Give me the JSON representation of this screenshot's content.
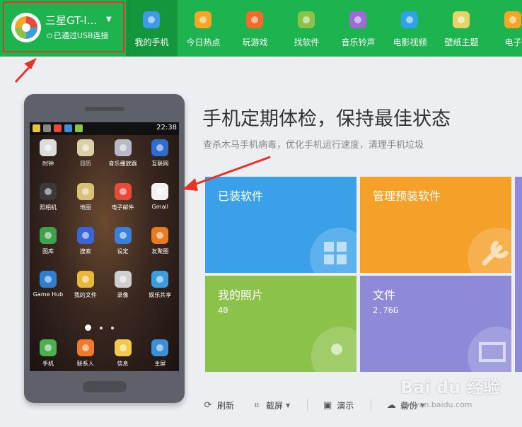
{
  "header": {
    "device_name": "三星GT-I...",
    "connection_status": "已通过USB连接",
    "nav": [
      {
        "label": "我的手机",
        "icon": "phone-icon",
        "color": "#3f9be8",
        "active": true
      },
      {
        "label": "今日热点",
        "icon": "star-icon",
        "color": "#f5a623"
      },
      {
        "label": "玩游戏",
        "icon": "gamepad-icon",
        "color": "#f26b2a"
      },
      {
        "label": "找软件",
        "icon": "android-icon",
        "color": "#8bc34a"
      },
      {
        "label": "音乐铃声",
        "icon": "music-icon",
        "color": "#9b6bd6"
      },
      {
        "label": "电影视频",
        "icon": "play-icon",
        "color": "#2ea4e6"
      },
      {
        "label": "壁纸主题",
        "icon": "wallpaper-icon",
        "color": "#e6d26a"
      },
      {
        "label": "电子",
        "icon": "ebook-icon",
        "color": "#f5a623"
      }
    ]
  },
  "phone": {
    "time": "22:38",
    "apps": [
      {
        "label": "时钟",
        "icon": "clock-icon",
        "color": "#dcdcdc"
      },
      {
        "label": "日历",
        "icon": "calendar-icon",
        "color": "#d9d0a8"
      },
      {
        "label": "音乐播放器",
        "icon": "music-player-icon",
        "color": "#b8b8c8"
      },
      {
        "label": "互联网",
        "icon": "globe-icon",
        "color": "#2f6bd1"
      },
      {
        "label": "照相机",
        "icon": "camera-icon",
        "color": "#3a3a3a"
      },
      {
        "label": "地图",
        "icon": "map-icon",
        "color": "#d8c27a"
      },
      {
        "label": "电子邮件",
        "icon": "email-icon",
        "color": "#e84a3a"
      },
      {
        "label": "Gmail",
        "icon": "gmail-icon",
        "color": "#f2f2f2"
      },
      {
        "label": "图库",
        "icon": "gallery-icon",
        "color": "#3fa24a"
      },
      {
        "label": "搜索",
        "icon": "search-icon",
        "color": "#3a64d8"
      },
      {
        "label": "设定",
        "icon": "settings-icon",
        "color": "#3a7fd8"
      },
      {
        "label": "友聚圈",
        "icon": "social-icon",
        "color": "#e87a1f"
      },
      {
        "label": "Game Hub",
        "icon": "game-hub-icon",
        "color": "#2e7fd1"
      },
      {
        "label": "我的文件",
        "icon": "folder-icon",
        "color": "#e8b83a"
      },
      {
        "label": "录像",
        "icon": "video-icon",
        "color": "#cfcfcf"
      },
      {
        "label": "娱乐共享",
        "icon": "share-icon",
        "color": "#3a9de0"
      }
    ],
    "dock": [
      {
        "label": "手机",
        "icon": "dial-icon",
        "color": "#4caf50"
      },
      {
        "label": "联系人",
        "icon": "contacts-icon",
        "color": "#f07a2a"
      },
      {
        "label": "信息",
        "icon": "message-icon",
        "color": "#f2c94c"
      },
      {
        "label": "主屏",
        "icon": "home-icon",
        "color": "#3a8fd8"
      }
    ]
  },
  "main": {
    "headline": "手机定期体检，保持最佳状态",
    "subline": "查杀木马手机病毒，优化手机运行速度，清理手机垃圾",
    "tiles": [
      {
        "title": "已装软件",
        "value": "",
        "icon": "apps-icon"
      },
      {
        "title": "管理预装软件",
        "value": "",
        "icon": "wrench-icon"
      },
      {
        "title": "我的照片",
        "value": "40",
        "icon": "photo-icon"
      },
      {
        "title": "文件",
        "value": "2.76G",
        "icon": "file-folder-icon"
      }
    ],
    "toolbar": [
      {
        "label": "刷新",
        "icon": "refresh-icon",
        "caret": false
      },
      {
        "label": "截屏",
        "icon": "crop-icon",
        "caret": true
      },
      {
        "label": "演示",
        "icon": "present-icon",
        "caret": false
      },
      {
        "label": "备份",
        "icon": "cloud-icon",
        "caret": true
      }
    ]
  },
  "watermark": {
    "text": "Bai du 经验",
    "sub": "jingyan.baidu.com"
  }
}
